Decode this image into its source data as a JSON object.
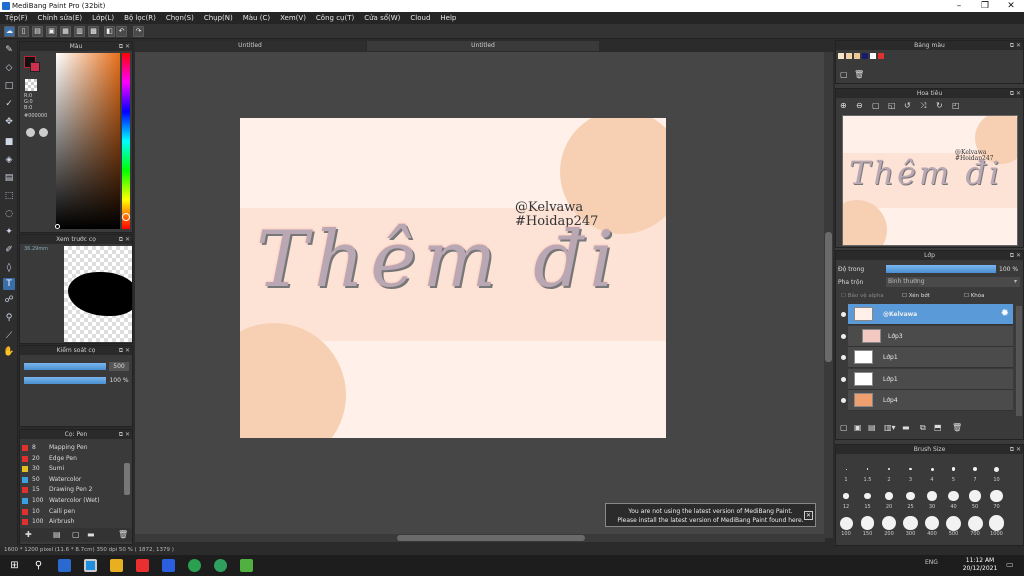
{
  "window": {
    "title": "MediBang Paint Pro (32bit)",
    "min": "–",
    "max": "❐",
    "close": "✕"
  },
  "menu": [
    "Tệp(F)",
    "Chỉnh sửa(E)",
    "Lớp(L)",
    "Bộ lọc(R)",
    "Chọn(S)",
    "Chụp(N)",
    "Màu (C)",
    "Xem(V)",
    "Công cụ(T)",
    "Cửa sổ(W)",
    "Cloud",
    "Help"
  ],
  "doc_tabs": [
    "Untitled",
    "Untitled"
  ],
  "color_panel": {
    "title": "Màu",
    "r": "R:0",
    "g": "G:0",
    "b": "B:0",
    "hex": "#000000",
    "icon_sel": "gear-icon"
  },
  "preview_panel": {
    "title": "Xem trước cọ",
    "size": "36.29mm"
  },
  "brush_control": {
    "title": "Kiểm soát cọ",
    "size": "500",
    "opacity": "100 %"
  },
  "brush_panel": {
    "title": "Cọ: Pen",
    "items": [
      {
        "size": "8",
        "name": "Mapping Pen",
        "color": "#e03030"
      },
      {
        "size": "20",
        "name": "Edge Pen",
        "color": "#e03030"
      },
      {
        "size": "30",
        "name": "Sumi",
        "color": "#e0c020"
      },
      {
        "size": "50",
        "name": "Watercolor",
        "color": "#3aa0e0"
      },
      {
        "size": "15",
        "name": "Drawing Pen 2",
        "color": "#e03030"
      },
      {
        "size": "100",
        "name": "Watercolor (Wet)",
        "color": "#3aa0e0"
      },
      {
        "size": "10",
        "name": "Calli pen",
        "color": "#e03030"
      },
      {
        "size": "100",
        "name": "Airbrush",
        "color": "#e03030"
      }
    ]
  },
  "artwork": {
    "text1": "@Kelvawa",
    "text2": "#Hoidap247",
    "main_text": "Thêm đi"
  },
  "notification": {
    "line1": "You are not using the latest version of MediBang Paint.",
    "line2": "Please install the latest version of MediBang Paint found here.",
    "close": "✕"
  },
  "status": {
    "text": "1600 * 1200 pixel   (11.6 * 8.7cm)   350 dpi   50 %   ( 1872, 1379 )"
  },
  "right": {
    "palette_title": "Bảng màu",
    "navigator_title": "Hoa tiêu",
    "layer_title": "Lớp",
    "opacity_label": "Độ trong",
    "opacity_value": "100 %",
    "opacity_fraction": 1.0,
    "blend_label": "Pha trộn",
    "blend_value": "Bình thường",
    "protect_alpha": "Bảo vệ alpha",
    "clipping": "Xén bớt",
    "lock": "Khóa",
    "layers": [
      {
        "name": "@Kelvawa",
        "selected": true
      },
      {
        "name": "Lớp3",
        "selected": false
      },
      {
        "name": "Lớp1",
        "selected": false
      },
      {
        "name": "Lớp1",
        "selected": false
      },
      {
        "name": "Lớp4",
        "selected": false
      }
    ],
    "brush_size_title": "Brush Size",
    "brush_sizes": [
      [
        "1",
        "1.5",
        "2",
        "3",
        "4",
        "5",
        "7",
        "10"
      ],
      [
        "12",
        "15",
        "20",
        "25",
        "30",
        "40",
        "50",
        "70"
      ],
      [
        "100",
        "150",
        "200",
        "300",
        "400",
        "500",
        "700",
        "1000"
      ]
    ]
  },
  "taskbar": {
    "time": "11:12 AM",
    "date": "20/12/2021",
    "lang": "ENG"
  }
}
